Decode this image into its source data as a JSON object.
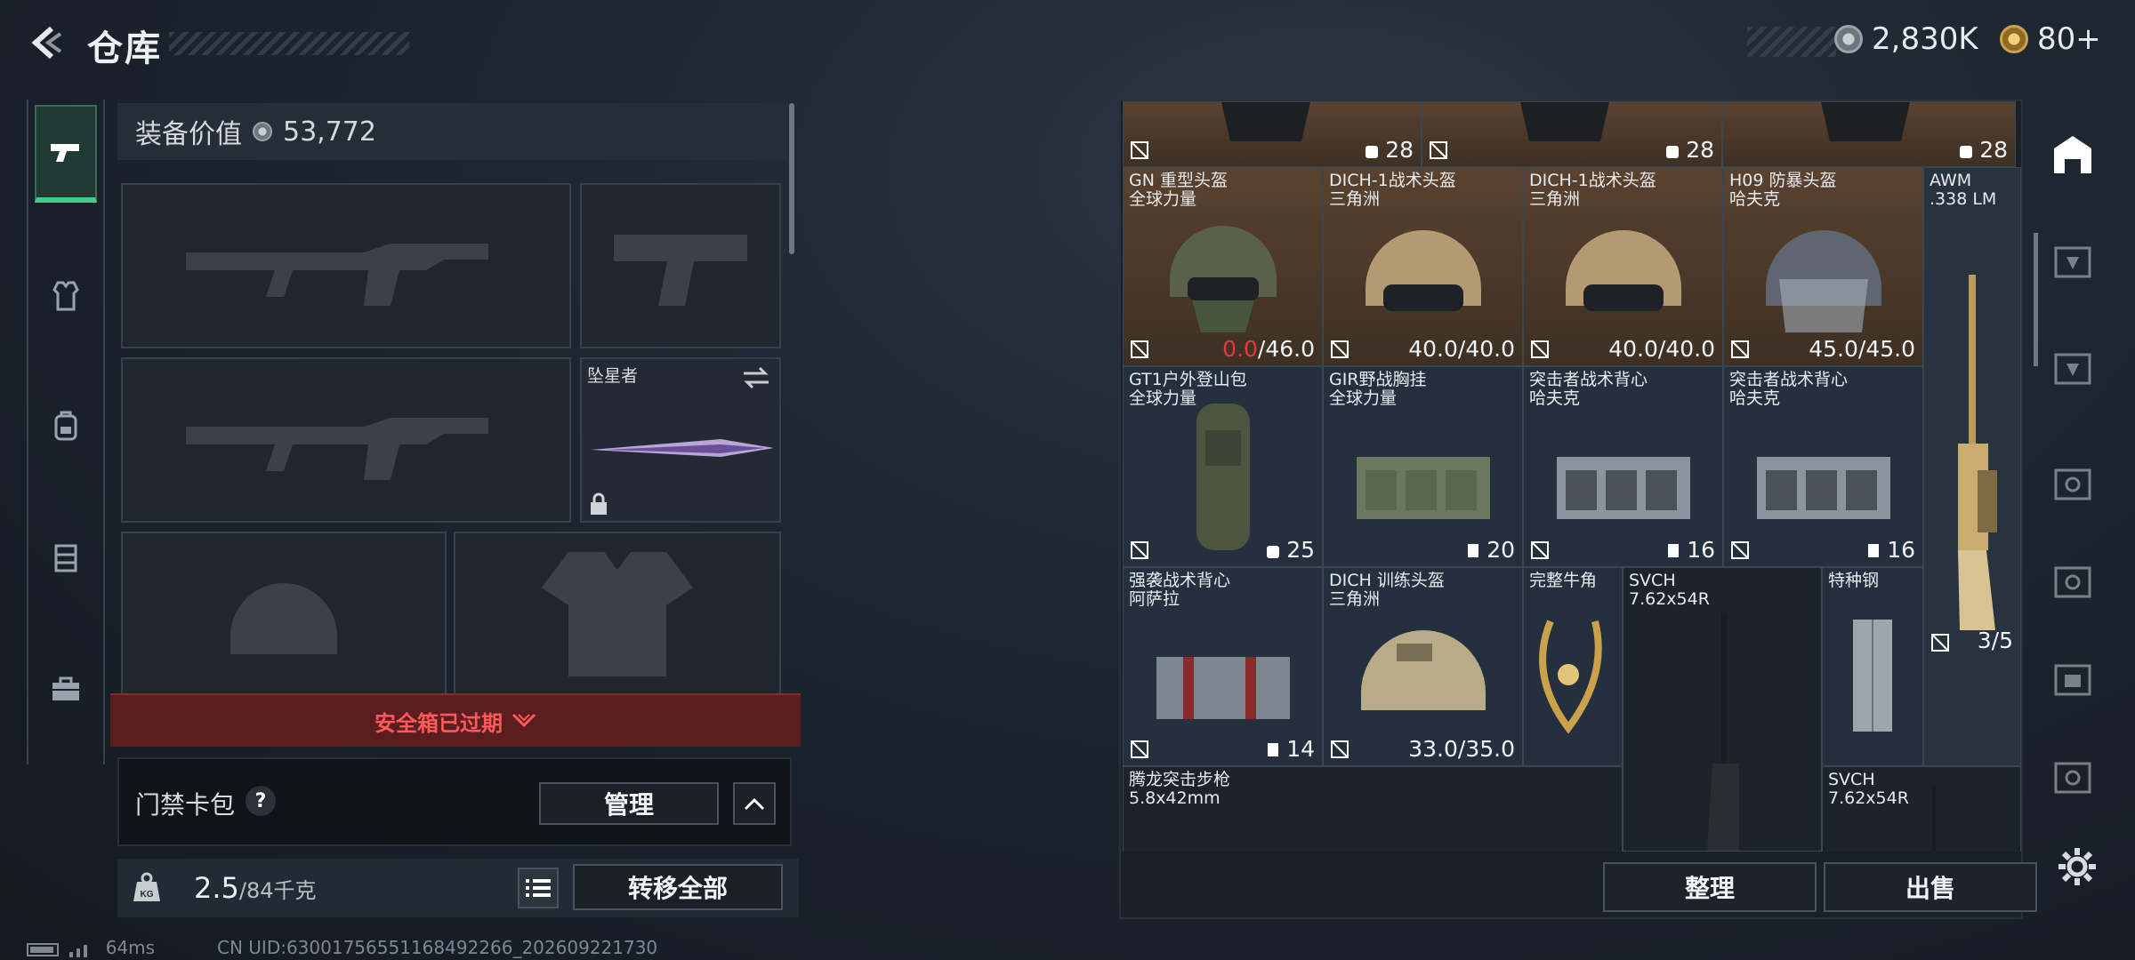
{
  "header": {
    "title": "仓库",
    "currency_silver": "2,830K",
    "currency_gold": "80+"
  },
  "equipment": {
    "value_label": "装备价值",
    "value": "53,772"
  },
  "slots": {
    "melee_name": "坠星者"
  },
  "safe_box": {
    "expired_label": "安全箱已过期"
  },
  "keycard": {
    "label": "门禁卡包",
    "help": "?",
    "manage_label": "管理"
  },
  "weight": {
    "current": "2.5",
    "max_unit": "/84千克",
    "transfer_all_label": "转移全部"
  },
  "footer": {
    "ping": "64ms",
    "uid": "CN UID:63001756551168492266_202609221730"
  },
  "top_row": [
    {
      "count": "28"
    },
    {
      "count": "28"
    },
    {
      "count": "28"
    }
  ],
  "items": [
    {
      "name1": "GN 重型头盔",
      "name2": "全球力量",
      "cur": "0.0",
      "max": "/46.0",
      "low": true
    },
    {
      "name1": "DICH-1战术头盔",
      "name2": "三角洲",
      "cur": "40.0",
      "max": "/40.0"
    },
    {
      "name1": "DICH-1战术头盔",
      "name2": "三角洲",
      "cur": "40.0",
      "max": "/40.0"
    },
    {
      "name1": "H09 防暴头盔",
      "name2": "哈夫克",
      "cur": "45.0",
      "max": "/45.0"
    },
    {
      "name1": "AWM",
      "name2": ".338 LM",
      "count": "3/5"
    },
    {
      "name1": "GT1户外登山包",
      "name2": "全球力量",
      "count": "25"
    },
    {
      "name1": "GIR野战胸挂",
      "name2": "全球力量",
      "count": "20"
    },
    {
      "name1": "突击者战术背心",
      "name2": "哈夫克",
      "count": "16"
    },
    {
      "name1": "突击者战术背心",
      "name2": "哈夫克",
      "count": "16"
    },
    {
      "name1": "强袭战术背心",
      "name2": "阿萨拉",
      "count": "14"
    },
    {
      "name1": "DICH 训练头盔",
      "name2": "三角洲",
      "cur": "33.0",
      "max": "/35.0"
    },
    {
      "name1": "完整牛角",
      "name2": ""
    },
    {
      "name1": "SVCH",
      "name2": "7.62x54R"
    },
    {
      "name1": "特种钢",
      "name2": ""
    },
    {
      "name1": "腾龙突击步枪",
      "name2": "5.8x42mm"
    },
    {
      "name1": "SVCH",
      "name2": "7.62x54R"
    }
  ],
  "actions": {
    "sort_label": "整理",
    "sell_label": "出售"
  }
}
